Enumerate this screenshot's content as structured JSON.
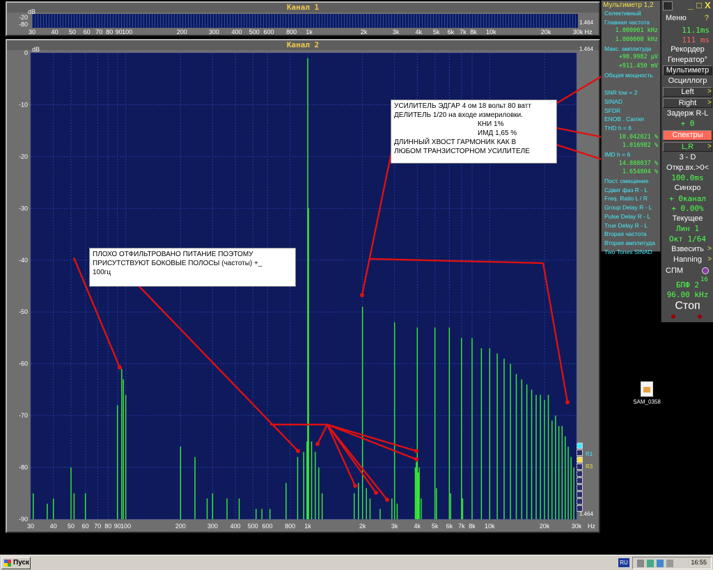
{
  "channel1": {
    "title": "Канал 1",
    "db_top": "dB",
    "y_ticks": [
      "-20",
      "-80"
    ],
    "right_value": "1.464",
    "x_ticks": [
      "30",
      "40",
      "50",
      "60",
      "70",
      "80",
      "90",
      "100",
      "200",
      "300",
      "400",
      "500",
      "600",
      "800",
      "1k",
      "2k",
      "3k",
      "4k",
      "5k",
      "6k",
      "7k",
      "8k",
      "10k",
      "20k",
      "30k"
    ],
    "x_unit": "Hz"
  },
  "channel2": {
    "title": "Канал 2",
    "db_label": "dB",
    "right_top": "1.464",
    "right_bottom": "1.464",
    "legend": [
      "R1",
      "R3"
    ]
  },
  "chart_data": {
    "type": "bar",
    "title": "Канал 2",
    "xlabel": "Hz",
    "ylabel": "dB",
    "x_scale": "log",
    "xlim": [
      30,
      30000
    ],
    "ylim": [
      -90,
      0
    ],
    "grid": true,
    "x_ticks": [
      "30",
      "40",
      "50",
      "60",
      "70",
      "80",
      "90",
      "100",
      "200",
      "300",
      "400",
      "500",
      "600",
      "800",
      "1k",
      "2k",
      "3k",
      "4k",
      "5k",
      "6k",
      "7k",
      "8k",
      "10k",
      "20k",
      "30k"
    ],
    "y_ticks": [
      "0",
      "-10",
      "-20",
      "-30",
      "-40",
      "-50",
      "-60",
      "-70",
      "-80",
      "-90"
    ],
    "series": [
      {
        "points": [
          [
            31,
            -85
          ],
          [
            37,
            -87
          ],
          [
            40,
            -86
          ],
          [
            50,
            -80
          ],
          [
            52,
            -85
          ],
          [
            60,
            -85
          ],
          [
            90,
            -68
          ],
          [
            95,
            -61
          ],
          [
            97,
            -63
          ],
          [
            100,
            -66
          ],
          [
            200,
            -76
          ],
          [
            240,
            -78
          ],
          [
            280,
            -86
          ],
          [
            300,
            -85
          ],
          [
            360,
            -86
          ],
          [
            420,
            -86
          ],
          [
            520,
            -88
          ],
          [
            560,
            -88
          ],
          [
            620,
            -88
          ],
          [
            760,
            -83
          ],
          [
            880,
            -78
          ],
          [
            950,
            -77
          ],
          [
            990,
            -75
          ],
          [
            1000,
            -1
          ],
          [
            1010,
            -30
          ],
          [
            1050,
            -75
          ],
          [
            1100,
            -77
          ],
          [
            1150,
            -80
          ],
          [
            1200,
            -85
          ],
          [
            1800,
            -85
          ],
          [
            1900,
            -83
          ],
          [
            2000,
            -49
          ],
          [
            2100,
            -84
          ],
          [
            2200,
            -86
          ],
          [
            2500,
            -88
          ],
          [
            2900,
            -86
          ],
          [
            3000,
            -52
          ],
          [
            3100,
            -87
          ],
          [
            3900,
            -80
          ],
          [
            3950,
            -79
          ],
          [
            4000,
            -53
          ],
          [
            4050,
            -81
          ],
          [
            4100,
            -80
          ],
          [
            4200,
            -86
          ],
          [
            5000,
            -53
          ],
          [
            5100,
            -84
          ],
          [
            6000,
            -53
          ],
          [
            6100,
            -85
          ],
          [
            7000,
            -55
          ],
          [
            7100,
            -86
          ],
          [
            8000,
            -55
          ],
          [
            9000,
            -57
          ],
          [
            10000,
            -57
          ],
          [
            11000,
            -58
          ],
          [
            12000,
            -59
          ],
          [
            13000,
            -60
          ],
          [
            14000,
            -62
          ],
          [
            15000,
            -63
          ],
          [
            16000,
            -64
          ],
          [
            17000,
            -65
          ],
          [
            18000,
            -66
          ],
          [
            19000,
            -66
          ],
          [
            20000,
            -67
          ],
          [
            21000,
            -66
          ],
          [
            22000,
            -71
          ],
          [
            23000,
            -70
          ],
          [
            24000,
            -72
          ],
          [
            25000,
            -72
          ],
          [
            26000,
            -74
          ],
          [
            27000,
            -76
          ],
          [
            28000,
            -78
          ],
          [
            29000,
            -80
          ]
        ]
      }
    ]
  },
  "multimeter": {
    "title": "Мультиметр 1,2",
    "rows": [
      {
        "label": "Селективный",
        "type": "label"
      },
      {
        "label": "Главная частота",
        "type": "label"
      },
      {
        "label": "1.000001 kHz",
        "type": "val"
      },
      {
        "label": "1.000000 kHz",
        "type": "val"
      },
      {
        "label": "Макс. амплитуда",
        "type": "label"
      },
      {
        "label": "+90.9982 µV",
        "type": "val"
      },
      {
        "label": "+911.450 mV",
        "type": "val"
      },
      {
        "label": "Общая мощность",
        "type": "label"
      },
      {
        "label": "",
        "type": "label"
      },
      {
        "label": "SNR    low = 2",
        "type": "label"
      },
      {
        "label": "SINAD",
        "type": "label"
      },
      {
        "label": "SFDR",
        "type": "label"
      },
      {
        "label": "ENOB . Carrier",
        "type": "label"
      },
      {
        "label": "THD      h =  6",
        "type": "label"
      },
      {
        "label": "10.042021 %",
        "type": "val"
      },
      {
        "label": "1.016982 %",
        "type": "val"
      },
      {
        "label": "IMD      h =  6",
        "type": "label"
      },
      {
        "label": "14.888037 %",
        "type": "val"
      },
      {
        "label": "1.654804 %",
        "type": "val"
      },
      {
        "label": "Пост. смещение",
        "type": "label"
      },
      {
        "label": "Сдвиг фаз R - L",
        "type": "label"
      },
      {
        "label": "Freq. Ratio  L / R",
        "type": "label"
      },
      {
        "label": "Group Delay R - L",
        "type": "label"
      },
      {
        "label": "Pulse Delay R - L",
        "type": "label"
      },
      {
        "label": "True Delay R - L",
        "type": "label"
      },
      {
        "label": "Вторая частота",
        "type": "label"
      },
      {
        "label": "Вторая амплитуда",
        "type": "label"
      },
      {
        "label": "Two Tones SINAD",
        "type": "label"
      }
    ]
  },
  "control": {
    "top_icons": [
      "_",
      "□",
      "X"
    ],
    "menu": "Меню",
    "menu_q": "?",
    "time1": "11.1ms",
    "time2": "111 ms",
    "recorder": "Рекордер",
    "generator": "Генератор°",
    "multimeter": "Мультиметр",
    "oscilloscope": "Осциллогр",
    "left": "Left",
    "right": "Right",
    "delay": "Задерж R-L",
    "delay_val": "+       0",
    "spectra": "Спектры",
    "lr": "L,R",
    "threed": "3 - D",
    "open": "Откр.вх.>0<",
    "open_val": "100.0ms",
    "sync": "Синхро",
    "sync_val1": "+  0канал",
    "sync_val2": "+  0.00%",
    "current": "Текущее",
    "lin": "Лин       1",
    "oct": "Окт  1/64",
    "weigh": "Взвесить",
    "hanning": "Hanning",
    "spm": "СПМ",
    "fft": "БПФ  2",
    "fft_exp": "16",
    "rate": "96.00 kHz",
    "stop": "Стоп"
  },
  "notes": {
    "amp": [
      "УСИЛИТЕЛЬ  ЭДГАР   4 ом   18 вольт  80 ватт",
      "ДЕЛИТЕЛЬ  1/20 на  входе  измериловки.",
      "КНИ  1%",
      "ИМД  1,65 %",
      "ДЛИННЫЙ  ХВОСТ  ГАРМОНИК  КАК  В",
      "ЛЮБОМ  ТРАНЗИСТОРНОМ  УСИЛИТЕЛЕ"
    ],
    "power": [
      "ПЛОХО  ОТФИЛЬТРОВАНО  ПИТАНИЕ  ПОЭТОМУ",
      "ПРИСУТСТВУЮТ  БОКОВЫЕ  ПОЛОСЫ  (частоты)  +_",
      "100гц"
    ]
  },
  "desktop_icon": "SAM_0358",
  "taskbar": {
    "start": "Пуск",
    "lang": "RU",
    "time": "16:55"
  },
  "colors": {
    "plot_bg": "#0e1a5c",
    "grid": "#2a3aa0",
    "trace": "#39e639",
    "annotation": "#e01010",
    "spectra_btn": "#ff6a5a"
  }
}
